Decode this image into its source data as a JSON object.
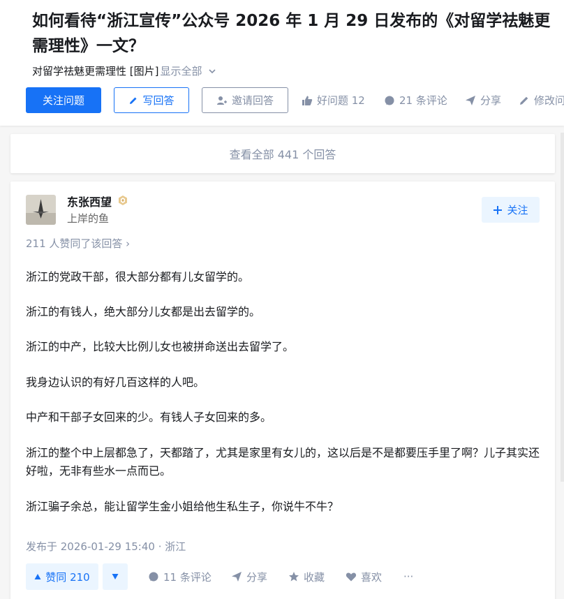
{
  "question": {
    "title": "如何看待“浙江宣传”公众号 2026 年 1 月 29 日发布的《对留学祛魅更需理性》一文？",
    "detail": "对留学祛魅更需理性 [图片]",
    "show_all": "显示全部",
    "follow_label": "关注问题",
    "write_label": "写回答",
    "invite_label": "邀请回答",
    "good_question": "好问题 12",
    "comments": "21 条评论",
    "share": "分享",
    "edit": "修改问"
  },
  "view_all": "查看全部 441 个回答",
  "answer": {
    "author_name": "东张西望",
    "author_bio": "上岸的鱼",
    "follow_label": "关注",
    "votes_summary": "211 人赞同了该回答 ›",
    "paragraphs": [
      "浙江的党政干部，很大部分都有儿女留学的。",
      "浙江的有钱人，绝大部分儿女都是出去留学的。",
      "浙江的中产，比较大比例儿女也被拼命送出去留学了。",
      "我身边认识的有好几百这样的人吧。",
      "中产和干部子女回来的少。有钱人子女回来的多。",
      "浙江的整个中上层都急了，天都踏了，尤其是家里有女儿的，这以后是不是都要压手里了啊？儿子其实还好啦，无非有些水一点而已。",
      "浙江骗子余总，能让留学生金小姐给他生私生子，你说牛不牛？"
    ],
    "published": "发布于 2026-01-29 15:40 · 浙江",
    "upvote_label": "赞同 210",
    "comments": "11 条评论",
    "share": "分享",
    "favorite": "收藏",
    "like": "喜欢",
    "more": "···"
  },
  "colors": {
    "brand_blue": "#1772f6",
    "light_blue_bg": "#ebf5ff",
    "gray_text": "#8590a6",
    "badge_gold": "#d9b06b"
  }
}
